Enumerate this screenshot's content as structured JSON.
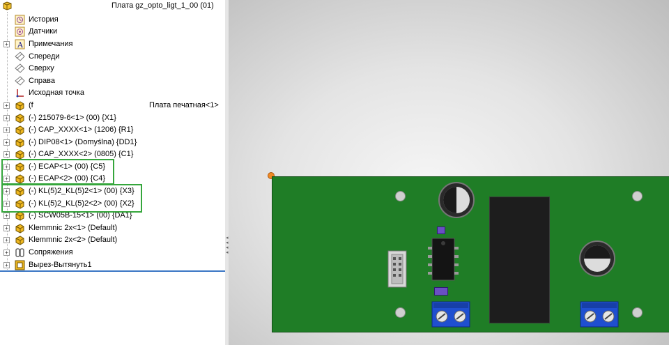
{
  "document": {
    "title": "Плата gz_opto_ligt_1_00  (01)"
  },
  "tree": {
    "items": [
      {
        "label": "История",
        "icon": "history-icon",
        "expander": ""
      },
      {
        "label": "Датчики",
        "icon": "sensors-icon",
        "expander": ""
      },
      {
        "label": "Примечания",
        "icon": "annotations-icon",
        "expander": "+"
      },
      {
        "label": "Спереди",
        "icon": "plane-icon",
        "expander": ""
      },
      {
        "label": "Сверху",
        "icon": "plane-icon",
        "expander": ""
      },
      {
        "label": "Справа",
        "icon": "plane-icon",
        "expander": ""
      },
      {
        "label": "Исходная точка",
        "icon": "origin-icon",
        "expander": ""
      },
      {
        "label": "(f",
        "label2": "Плата печатная<1>",
        "icon": "part-icon",
        "expander": "+"
      },
      {
        "label": "(-) 215079-6<1> (00) {X1}",
        "icon": "part-icon",
        "expander": "+"
      },
      {
        "label": "(-) CAP_XXXX<1> (1206) {R1}",
        "icon": "part-icon",
        "expander": "+"
      },
      {
        "label": "(-) DIP08<1> (Domyślna) {DD1}",
        "icon": "part-icon",
        "expander": "+"
      },
      {
        "label": "(-) CAP_XXXX<2> (0805) {C1}",
        "icon": "part-icon",
        "expander": "+"
      },
      {
        "label": "(-) ECAP<1> (00) {C5}",
        "icon": "part-icon",
        "expander": "+"
      },
      {
        "label": "(-) ECAP<2> (00) {C4}",
        "icon": "part-icon",
        "expander": "+"
      },
      {
        "label": "(-) KL(5)2_KL(5)2<1> (00) {X3}",
        "icon": "part-icon",
        "expander": "+"
      },
      {
        "label": "(-) KL(5)2_KL(5)2<2> (00) {X2}",
        "icon": "part-icon",
        "expander": "+"
      },
      {
        "label": "(-) SCW05B-15<1> (00) {DA1}",
        "icon": "part-icon",
        "expander": "+"
      },
      {
        "label": "Klemmnic 2x<1> (Default)",
        "icon": "part-icon",
        "expander": "+"
      },
      {
        "label": "Klemmnic 2x<2> (Default)",
        "icon": "part-icon",
        "expander": "+"
      },
      {
        "label": "Сопряжения",
        "icon": "mates-icon",
        "expander": "+"
      },
      {
        "label": "Вырез-Вытянуть1",
        "icon": "cut-extrude-icon",
        "expander": "+"
      }
    ]
  },
  "colors": {
    "highlight": "#35a63c",
    "board": "#1f7d26",
    "terminal": "#1f4fd0",
    "selection_line": "#3a76c4"
  }
}
